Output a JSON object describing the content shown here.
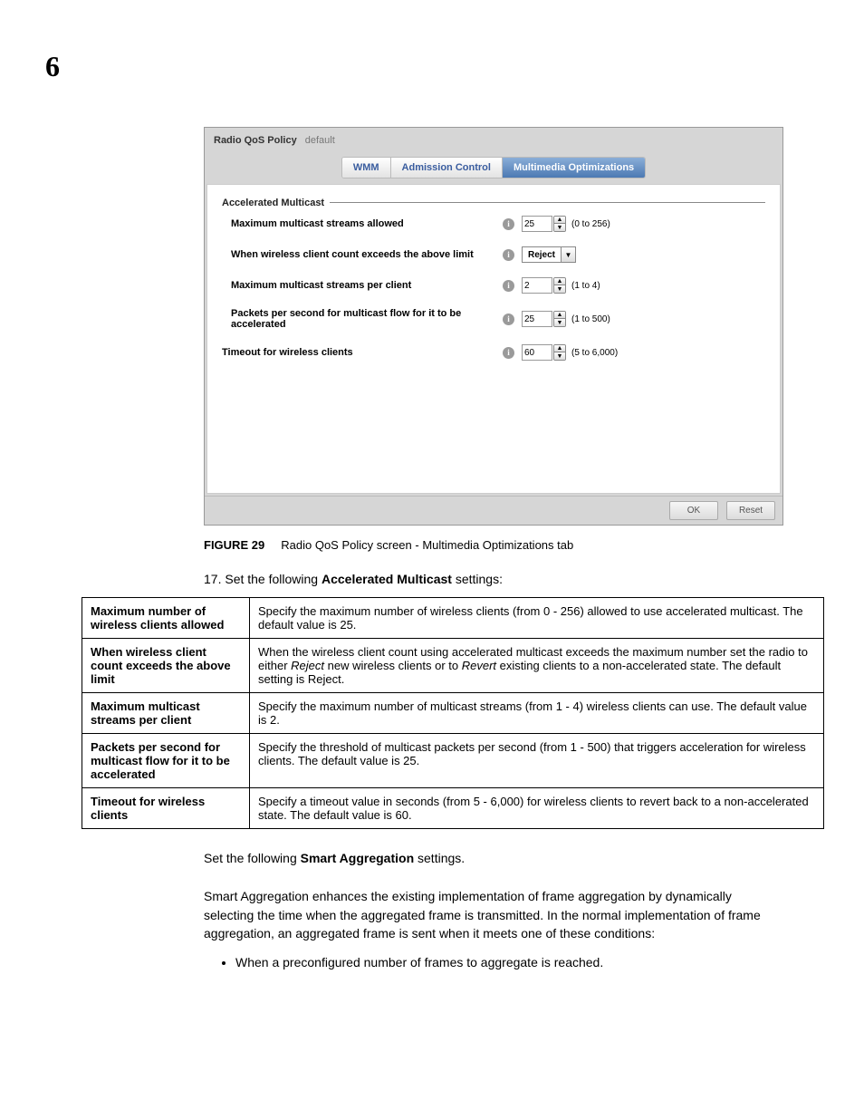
{
  "page_number": "6",
  "panel": {
    "title": "Radio QoS Policy",
    "name": "default",
    "tabs": {
      "wmm": "WMM",
      "admission": "Admission Control",
      "multimedia": "Multimedia Optimizations"
    },
    "fieldset": "Accelerated Multicast",
    "rows": {
      "max_streams_allowed": {
        "label": "Maximum multicast streams allowed",
        "value": "25",
        "range": "(0 to 256)"
      },
      "when_exceeds": {
        "label": "When wireless client count exceeds the above limit",
        "value": "Reject"
      },
      "max_per_client": {
        "label": "Maximum multicast streams per client",
        "value": "2",
        "range": "(1 to 4)"
      },
      "pps": {
        "label": "Packets per second for multicast flow for it to be accelerated",
        "value": "25",
        "range": "(1 to 500)"
      },
      "timeout": {
        "label": "Timeout for wireless clients",
        "value": "60",
        "range": "(5 to 6,000)"
      }
    },
    "buttons": {
      "ok": "OK",
      "reset": "Reset"
    }
  },
  "caption": {
    "fig": "FIGURE 29",
    "text": "Radio QoS Policy screen - Multimedia Optimizations tab"
  },
  "step17": {
    "prefix": "17.  Set the following ",
    "bold": "Accelerated Multicast",
    "suffix": " settings:"
  },
  "table": {
    "r1": {
      "term": "Maximum number of wireless clients allowed",
      "desc": "Specify the maximum number of wireless clients (from 0 - 256) allowed to use accelerated multicast. The default value is 25."
    },
    "r2": {
      "term": "When wireless client count exceeds the above limit",
      "desc_a": "When the wireless client count using accelerated multicast exceeds the maximum number set the radio to either ",
      "ital1": "Reject",
      "desc_b": " new wireless clients or to ",
      "ital2": "Revert",
      "desc_c": " existing clients to a non-accelerated state. The default setting is Reject."
    },
    "r3": {
      "term": "Maximum multicast streams per client",
      "desc": "Specify the maximum number of multicast streams (from 1 - 4) wireless clients can use. The default value is 2."
    },
    "r4": {
      "term": "Packets per second for multicast flow for it to be accelerated",
      "desc": "Specify the threshold of multicast packets per second (from 1 - 500) that triggers acceleration for wireless clients. The default value is 25."
    },
    "r5": {
      "term": "Timeout for wireless clients",
      "desc": "Specify a timeout value in seconds (from 5 - 6,000) for wireless clients to revert back to a non-accelerated state. The default value is 60."
    }
  },
  "para1": {
    "a": "Set the following ",
    "bold": "Smart Aggregation",
    "b": " settings."
  },
  "para2": "Smart Aggregation enhances the existing implementation of frame aggregation by dynamically selecting the time when the aggregated frame is transmitted. In the normal implementation of frame aggregation, an aggregated frame is sent when it meets one of these conditions:",
  "bullet1": "When a preconfigured number of frames to aggregate is reached."
}
